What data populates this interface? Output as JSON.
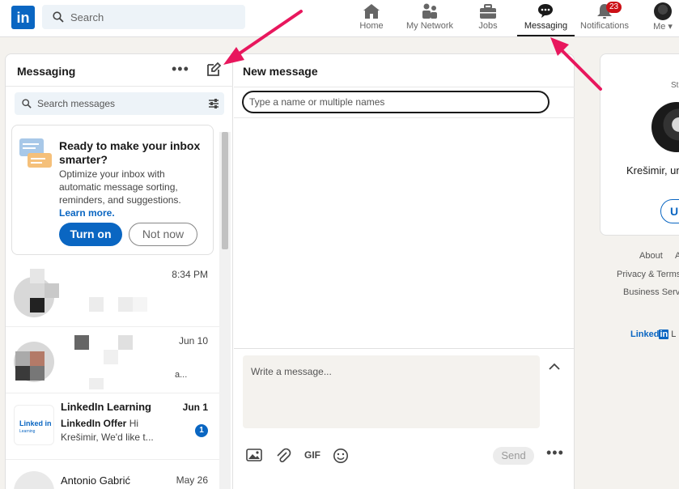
{
  "topnav": {
    "logo_text": "in",
    "search_placeholder": "Search",
    "items": [
      {
        "label": "Home",
        "icon": "home-icon"
      },
      {
        "label": "My Network",
        "icon": "network-icon"
      },
      {
        "label": "Jobs",
        "icon": "briefcase-icon"
      },
      {
        "label": "Messaging",
        "icon": "messaging-icon",
        "active": true
      },
      {
        "label": "Notifications",
        "icon": "bell-icon",
        "badge": "23"
      },
      {
        "label": "Me",
        "icon": "avatar"
      }
    ]
  },
  "messaging": {
    "title": "Messaging",
    "more_label": "•••",
    "search_placeholder": "Search messages",
    "promo": {
      "title": "Ready to make your inbox smarter?",
      "body": "Optimize your inbox with automatic message sorting, reminders, and suggestions.",
      "link": "Learn more.",
      "primary_button": "Turn on",
      "secondary_button": "Not now"
    },
    "conversations": [
      {
        "time": "8:34 PM"
      },
      {
        "time": "Jun 10",
        "preview": "a..."
      },
      {
        "name": "LinkedIn Learning",
        "time": "Jun 1",
        "sender": "LinkedIn Offer",
        "preview": "Hi Krešimir, We'd like t...",
        "unread": "1",
        "logo_text": "Linked in",
        "logo_sub": "Learning"
      },
      {
        "name": "Antonio Gabrić",
        "time": "May 26"
      }
    ]
  },
  "new_message": {
    "title": "New message",
    "to_placeholder": "Type a name or multiple names",
    "write_placeholder": "Write a message...",
    "gif_label": "GIF",
    "send_label": "Send",
    "more_label": "•••"
  },
  "profile": {
    "st_label": "St",
    "name": "Krešimir, un",
    "button": "U"
  },
  "footer": {
    "about": "About",
    "a": "A",
    "privacy": "Privacy & Terms",
    "business": "Business Servic",
    "logo_text": "Linked",
    "logo_in": "in",
    "logo_suffix": "L"
  },
  "colors": {
    "brand": "#0a66c2",
    "annotation_arrow": "#e8175d",
    "badge": "#cc1016"
  }
}
